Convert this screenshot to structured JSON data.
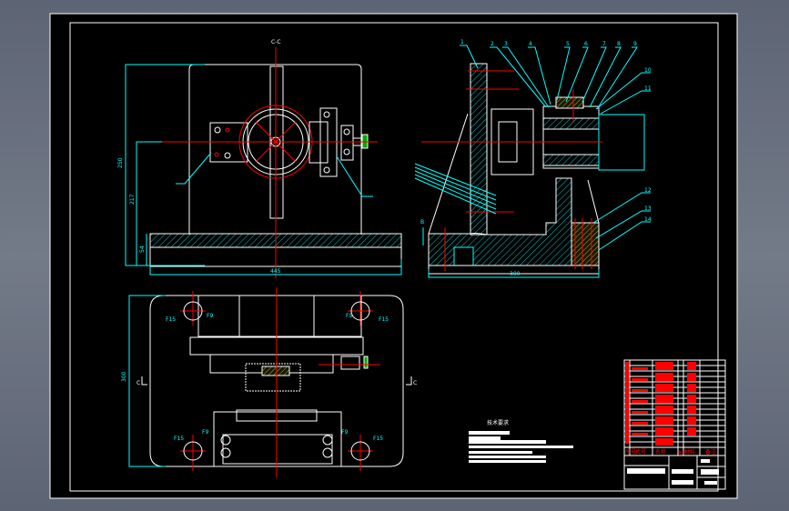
{
  "colors": {
    "sheet": "#000000",
    "outline": "#ffffff",
    "centerline": "#ff0000",
    "dimension": "#00ffff",
    "hatch": "#00ffff",
    "knurl": "#00cc00",
    "bom_text": "#ff0000"
  },
  "section_view": {
    "label": "C-C",
    "dims": {
      "height_total": "250",
      "height_center": "217",
      "base_thickness": "54",
      "width": "445"
    }
  },
  "side_view": {
    "part_numbers": [
      "1",
      "2",
      "3",
      "4",
      "5",
      "6",
      "7",
      "8",
      "9",
      "10",
      "11",
      "12",
      "13",
      "14"
    ],
    "datum": "B",
    "width_dim": "300"
  },
  "plan_view": {
    "section_mark_left": "C",
    "section_mark_right": "C",
    "height_dim": "300",
    "callouts": [
      "F15",
      "F9",
      "F9",
      "F15",
      "F15",
      "F9",
      "F9",
      "F15"
    ]
  },
  "tech_requirements": {
    "title": "技术要求"
  },
  "title_block": {
    "headers": [
      "序号",
      "代号",
      "名称",
      "数量",
      "材料",
      "备注"
    ]
  }
}
